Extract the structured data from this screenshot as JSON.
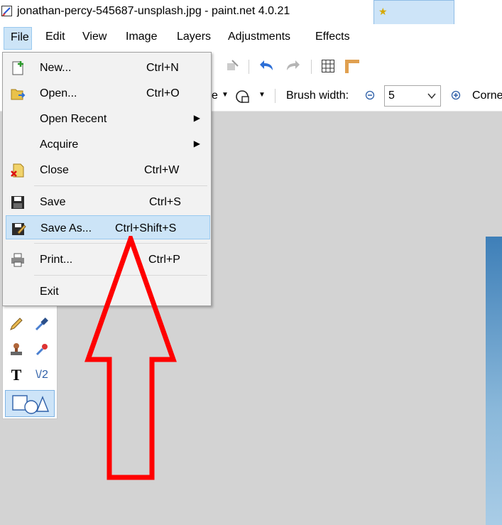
{
  "window": {
    "title": "jonathan-percy-545687-unsplash.jpg - paint.net 4.0.21"
  },
  "menubar": {
    "items": [
      {
        "label": "File"
      },
      {
        "label": "Edit"
      },
      {
        "label": "View"
      },
      {
        "label": "Image"
      },
      {
        "label": "Layers"
      },
      {
        "label": "Adjustments"
      },
      {
        "label": "Effects"
      }
    ]
  },
  "file_menu": {
    "items": [
      {
        "label": "New...",
        "shortcut": "Ctrl+N",
        "icon": "new-document-icon"
      },
      {
        "label": "Open...",
        "shortcut": "Ctrl+O",
        "icon": "open-folder-icon"
      },
      {
        "label": "Open Recent",
        "shortcut": "",
        "submenu": true
      },
      {
        "label": "Acquire",
        "shortcut": "",
        "submenu": true
      },
      {
        "label": "Close",
        "shortcut": "Ctrl+W",
        "icon": "close-document-icon"
      },
      {
        "label": "Save",
        "shortcut": "Ctrl+S",
        "icon": "floppy-disk-icon"
      },
      {
        "label": "Save As...",
        "shortcut": "Ctrl+Shift+S",
        "icon": "save-as-icon",
        "highlighted": true
      },
      {
        "label": "Print...",
        "shortcut": "Ctrl+P",
        "icon": "printer-icon"
      },
      {
        "label": "Exit",
        "shortcut": ""
      }
    ]
  },
  "toolbar": {
    "brush_width_label": "Brush width:",
    "brush_width_value": "5",
    "fill_suffix": "e",
    "corner_label": "Corne"
  },
  "colors": {
    "highlight": "#cce4f7",
    "highlight_border": "#99c9ef",
    "annotation_arrow": "#ff0000",
    "canvas_bg": "#d3d3d3"
  }
}
